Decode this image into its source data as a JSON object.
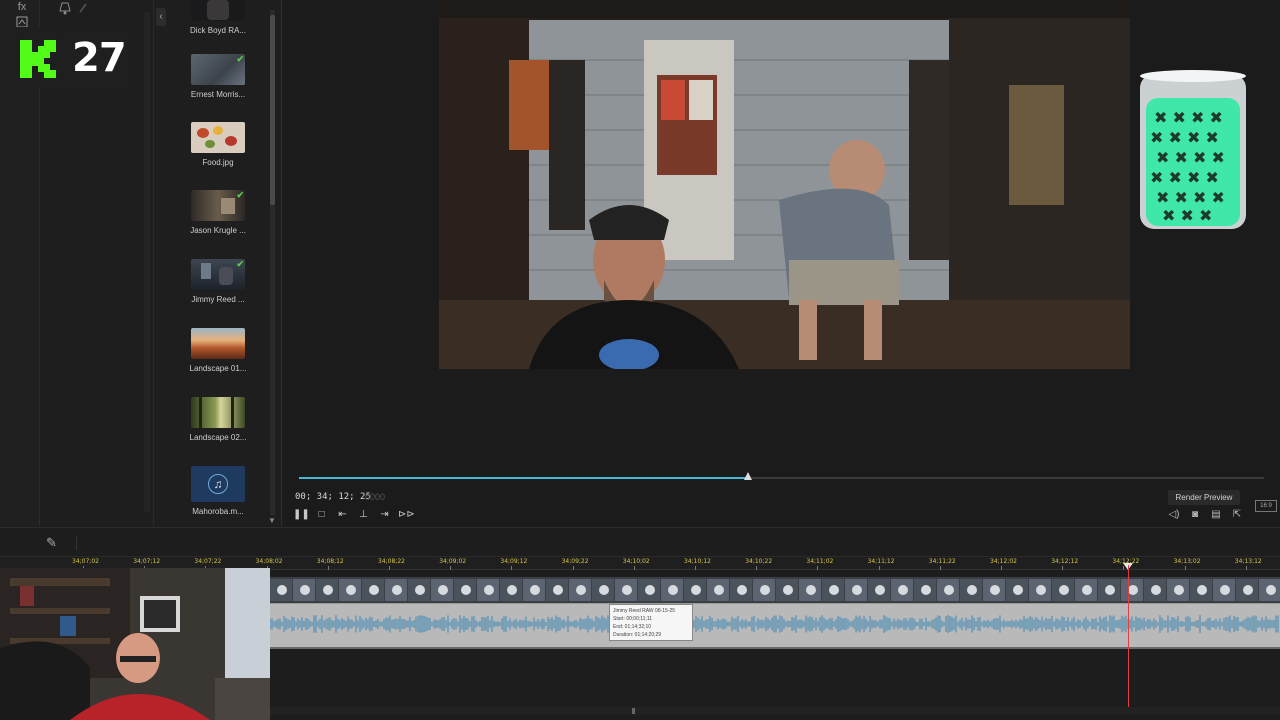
{
  "overlay": {
    "count": "27",
    "logo": "k-logo-icon"
  },
  "toolstrip": {
    "icons": [
      "fx-icon",
      "transition-icon",
      "more-icon"
    ],
    "fx_label": "fx"
  },
  "library": {
    "items": [
      {
        "label": "Dick Boyd RA...",
        "checked": false,
        "thumb": "dark"
      },
      {
        "label": "Ernest Morris...",
        "checked": true,
        "thumb": "grey"
      },
      {
        "label": "Food.jpg",
        "checked": false,
        "thumb": "food"
      },
      {
        "label": "Jason Krugle ...",
        "checked": true,
        "thumb": "room"
      },
      {
        "label": "Jimmy Reed ...",
        "checked": true,
        "thumb": "porch"
      },
      {
        "label": "Landscape 01...",
        "checked": false,
        "thumb": "landscape1"
      },
      {
        "label": "Landscape 02...",
        "checked": false,
        "thumb": "landscape2"
      },
      {
        "label": "Mahoroba.m...",
        "checked": false,
        "thumb": "music"
      }
    ]
  },
  "preview": {
    "timecode": "00; 34; 12; 25",
    "timecode_dim": "0000",
    "progress": 0.465,
    "render_label": "Render Preview",
    "aspect_label": "16:9"
  },
  "transport": [
    "pause-icon",
    "stop-icon",
    "prev-frame-icon",
    "snapshot-marker-icon",
    "next-frame-icon",
    "fast-forward-icon"
  ],
  "right_tools": [
    "volume-icon",
    "camera-icon",
    "subtitle-icon",
    "popout-icon"
  ],
  "timeline": {
    "ruler_labels": [
      "34;07;02",
      "34;07;12",
      "34;07;22",
      "34;08;02",
      "34;08;12",
      "34;08;22",
      "34;09;02",
      "34;09;12",
      "34;09;22",
      "34;10;02",
      "34;10;12",
      "34;10;22",
      "34;11;02",
      "34;11;12",
      "34;11;22",
      "34;12;02",
      "34;12;12",
      "34;12;22",
      "34;13;02",
      "34;13;12"
    ],
    "tooltip": {
      "line1": "Jimmy Reed RAW 08-15-25",
      "line2": "Start: 00;00;11;11",
      "line3": "End: 01;14;32;10",
      "line4": "Duration: 01;14;20;29"
    }
  }
}
